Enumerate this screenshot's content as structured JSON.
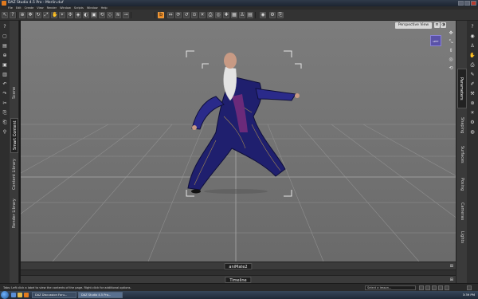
{
  "window": {
    "title": "DAZ Studio 4.5 Pro - Merlin.duf",
    "buttons": [
      "minimize",
      "maximize",
      "close"
    ]
  },
  "menubar": {
    "items": [
      "File",
      "Edit",
      "Create",
      "View",
      "Render",
      "Window",
      "Scripts",
      "Window",
      "Help"
    ]
  },
  "toolbar": {
    "buttons": [
      {
        "icon": "arrow-select-icon",
        "glyph": "↖"
      },
      {
        "icon": "help-icon",
        "glyph": "?"
      },
      {
        "icon": "node-select-icon",
        "glyph": "⊕"
      },
      {
        "icon": "move-icon",
        "glyph": "✥"
      },
      {
        "icon": "rotate-icon",
        "glyph": "↻"
      },
      {
        "icon": "scale-icon",
        "glyph": "⤢"
      },
      {
        "icon": "pose-icon",
        "glyph": "✋"
      },
      {
        "icon": "joint-editor-icon",
        "glyph": "⌖"
      },
      {
        "icon": "universal-tool-icon",
        "glyph": "✣"
      },
      {
        "icon": "geometry-icon",
        "glyph": "◈"
      },
      {
        "icon": "surface-icon",
        "glyph": "◐"
      },
      {
        "icon": "region-icon",
        "glyph": "▣"
      },
      {
        "icon": "transform-icon",
        "glyph": "⟲"
      },
      {
        "icon": "morph-icon",
        "glyph": "◇"
      },
      {
        "icon": "hair-icon",
        "glyph": "≋"
      },
      {
        "icon": "bone-icon",
        "glyph": "⊸"
      },
      {
        "icon": "active-pose-icon",
        "glyph": "b",
        "active": true
      },
      {
        "icon": "translate-icon",
        "glyph": "⇔"
      },
      {
        "icon": "rotate-alt-icon",
        "glyph": "⟳"
      },
      {
        "icon": "twist-icon",
        "glyph": "↺"
      },
      {
        "icon": "zoom-icon",
        "glyph": "⊙"
      },
      {
        "icon": "light-icon",
        "glyph": "☀"
      },
      {
        "icon": "camera-icon",
        "glyph": "⎙"
      },
      {
        "icon": "spot-render-icon",
        "glyph": "◎"
      },
      {
        "icon": "puzzle-icon",
        "glyph": "✚"
      },
      {
        "icon": "grid-icon",
        "glyph": "▦"
      },
      {
        "icon": "figure-icon",
        "glyph": "♙"
      },
      {
        "icon": "image-icon",
        "glyph": "▤"
      },
      {
        "icon": "render-icon",
        "glyph": "◉"
      },
      {
        "icon": "render-settings-icon",
        "glyph": "⚙"
      },
      {
        "icon": "save-render-icon",
        "glyph": "⎘"
      }
    ]
  },
  "left_panel": {
    "tabs": [
      {
        "label": "Scene",
        "active": false
      },
      {
        "label": "Smart Content",
        "active": true
      },
      {
        "label": "Content Library",
        "active": false
      },
      {
        "label": "Render Library",
        "active": false
      }
    ],
    "icons": [
      "help-icon",
      "new-icon",
      "open-icon",
      "merge-icon",
      "save-icon",
      "save-as-icon",
      "undo-icon",
      "redo-icon",
      "cut-icon",
      "copy-icon",
      "paste-icon",
      "pin-icon"
    ]
  },
  "viewport": {
    "camera_label": "Perspective View",
    "nav_cube_label": "LEFT"
  },
  "right_panel": {
    "tabs": [
      {
        "label": "Parameters",
        "active": true
      },
      {
        "label": "Shaping",
        "active": false
      },
      {
        "label": "Surfaces",
        "active": false
      },
      {
        "label": "Posing",
        "active": false
      },
      {
        "label": "Cameras",
        "active": false
      },
      {
        "label": "Lights",
        "active": false
      }
    ],
    "icons": [
      "help-icon",
      "render-icon",
      "figure-icon",
      "pose-icon",
      "camera-icon",
      "paint-icon",
      "brush-icon",
      "tool-icon",
      "network-icon",
      "light-icon",
      "gear-icon",
      "globe-icon"
    ]
  },
  "bottom": {
    "pane1_label": "aniMate2",
    "pane2_label": "Timeline"
  },
  "statusbar": {
    "message": "Tabs: Left click a label to view the contents of the page. Right click for additional options.",
    "lesson_select": "Select a lesson..."
  },
  "taskbar": {
    "tasks": [
      {
        "label": "DAZ Discussion Foru...",
        "active": false
      },
      {
        "label": "DAZ Studio 4.5 Pro...",
        "active": true
      }
    ],
    "clock": "3:39 PM"
  }
}
